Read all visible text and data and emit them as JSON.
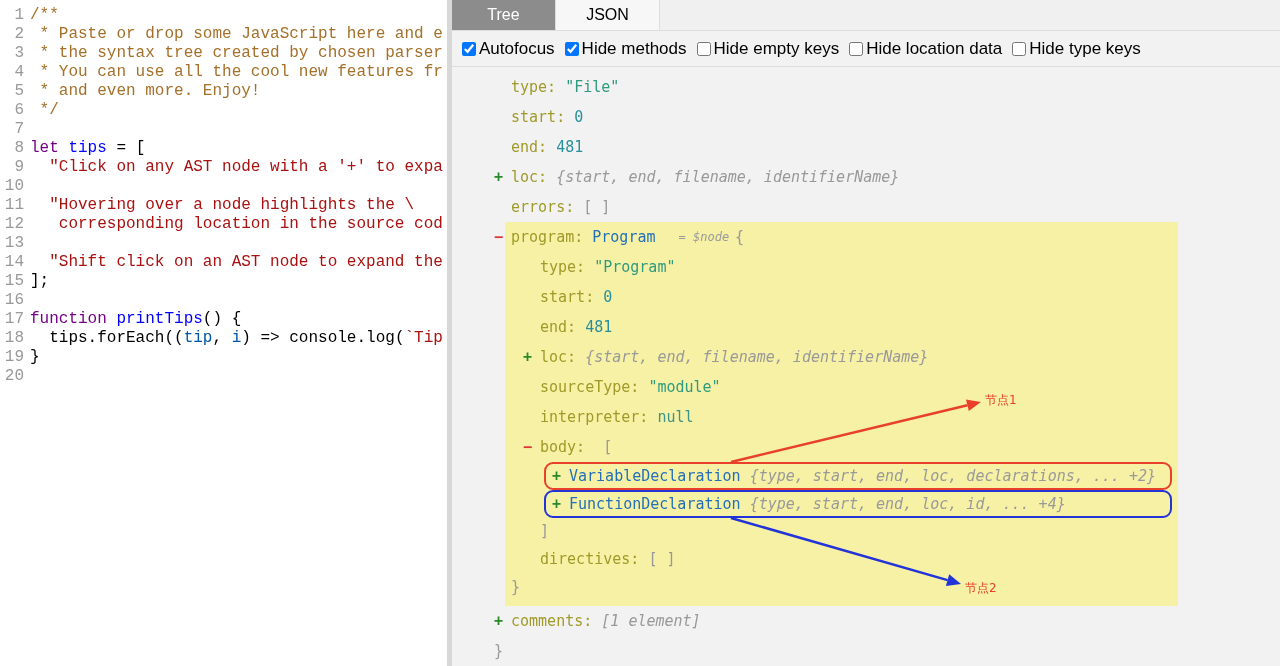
{
  "editor": {
    "lines": [
      {
        "number": "1",
        "tokens": [
          {
            "text": "/**",
            "kind": "comment"
          }
        ]
      },
      {
        "number": "2",
        "tokens": [
          {
            "text": " * Paste or drop some JavaScript here and e",
            "kind": "comment"
          }
        ]
      },
      {
        "number": "3",
        "tokens": [
          {
            "text": " * the syntax tree created by chosen parser",
            "kind": "comment"
          }
        ]
      },
      {
        "number": "4",
        "tokens": [
          {
            "text": " * You can use all the cool new features fr",
            "kind": "comment"
          }
        ]
      },
      {
        "number": "5",
        "tokens": [
          {
            "text": " * and even more. Enjoy!",
            "kind": "comment"
          }
        ]
      },
      {
        "number": "6",
        "tokens": [
          {
            "text": " */",
            "kind": "comment"
          }
        ]
      },
      {
        "number": "7"
      },
      {
        "number": "8",
        "tokens": [
          {
            "text": "let",
            "kind": "keyword"
          },
          {
            "text": " tips",
            "kind": "def"
          },
          {
            "text": " = [",
            "kind": "plain"
          }
        ]
      },
      {
        "number": "9",
        "tokens": [
          {
            "text": "  \"Click on any AST node with a '+' to expa",
            "kind": "string"
          }
        ]
      },
      {
        "number": "10"
      },
      {
        "number": "11",
        "tokens": [
          {
            "text": "  \"Hovering over a node highlights the \\",
            "kind": "string"
          }
        ]
      },
      {
        "number": "12",
        "tokens": [
          {
            "text": "   corresponding location in the source cod",
            "kind": "string"
          }
        ]
      },
      {
        "number": "13"
      },
      {
        "number": "14",
        "tokens": [
          {
            "text": "  \"Shift click on an AST node to expand the",
            "kind": "string"
          }
        ]
      },
      {
        "number": "15",
        "tokens": [
          {
            "text": "];",
            "kind": "plain"
          }
        ]
      },
      {
        "number": "16"
      },
      {
        "number": "17",
        "tokens": [
          {
            "text": "function",
            "kind": "keyword"
          },
          {
            "text": " printTips",
            "kind": "def"
          },
          {
            "text": "() {",
            "kind": "plain"
          }
        ]
      },
      {
        "number": "18",
        "tokens": [
          {
            "text": "  tips.forEach((",
            "kind": "plain"
          },
          {
            "text": "tip",
            "kind": "param"
          },
          {
            "text": ", ",
            "kind": "plain"
          },
          {
            "text": "i",
            "kind": "param"
          },
          {
            "text": ") => console.log(",
            "kind": "plain"
          },
          {
            "text": "`Tip",
            "kind": "string"
          }
        ]
      },
      {
        "number": "19",
        "tokens": [
          {
            "text": "}",
            "kind": "plain"
          }
        ]
      },
      {
        "number": "20"
      }
    ]
  },
  "output": {
    "tabs": [
      {
        "label": "Tree",
        "selected": true
      },
      {
        "label": "JSON",
        "selected": false
      }
    ],
    "options": [
      {
        "label": "Autofocus",
        "checked": true
      },
      {
        "label": "Hide methods",
        "checked": true
      },
      {
        "label": "Hide empty keys",
        "checked": false
      },
      {
        "label": "Hide location data",
        "checked": false
      },
      {
        "label": "Hide type keys",
        "checked": false
      }
    ],
    "tree": {
      "children": [
        {
          "label": "type:",
          "kind": "string",
          "value": "\"File\""
        },
        {
          "label": "start:",
          "kind": "number",
          "value": "0"
        },
        {
          "label": "end:",
          "kind": "number",
          "value": "481"
        },
        {
          "label": "loc:",
          "kind": "summary",
          "expanded": false,
          "toggle": "+",
          "value": "{start, end, filename, identifierName}"
        },
        {
          "label": "errors:",
          "kind": "empty",
          "value": "[ ]"
        },
        {
          "label": "program:",
          "kind": "object",
          "expanded": true,
          "toggle": "−",
          "highlighted": true,
          "type_name": "Program",
          "ref": "= $node",
          "open": "{",
          "close": "}",
          "children": [
            {
              "label": "type:",
              "kind": "string",
              "value": "\"Program\""
            },
            {
              "label": "start:",
              "kind": "number",
              "value": "0"
            },
            {
              "label": "end:",
              "kind": "number",
              "value": "481"
            },
            {
              "label": "loc:",
              "kind": "summary",
              "expanded": false,
              "toggle": "+",
              "value": "{start, end, filename, identifierName}"
            },
            {
              "label": "sourceType:",
              "kind": "string",
              "value": "\"module\""
            },
            {
              "label": "interpreter:",
              "kind": "null",
              "value": "null"
            },
            {
              "label": "body:",
              "kind": "array",
              "expanded": true,
              "toggle": "−",
              "open": "[",
              "close": "]",
              "children": [
                {
                  "kind": "summary",
                  "expanded": false,
                  "toggle": "+",
                  "type_name": "VariableDeclaration",
                  "value": "{type, start, end, loc, declarations, ... +2}",
                  "callout": {
                    "label": "节点1",
                    "color": "#e8402a"
                  }
                },
                {
                  "kind": "summary",
                  "expanded": false,
                  "toggle": "+",
                  "type_name": "FunctionDeclaration",
                  "value": "{type, start, end, loc, id, ... +4}",
                  "callout": {
                    "label": "节点2",
                    "color": "#2233d8"
                  }
                }
              ]
            },
            {
              "label": "directives:",
              "kind": "empty",
              "value": "[ ]"
            }
          ]
        },
        {
          "label": "comments:",
          "kind": "summary",
          "expanded": false,
          "toggle": "+",
          "value": "[1 element]"
        }
      ],
      "close": "}"
    }
  }
}
